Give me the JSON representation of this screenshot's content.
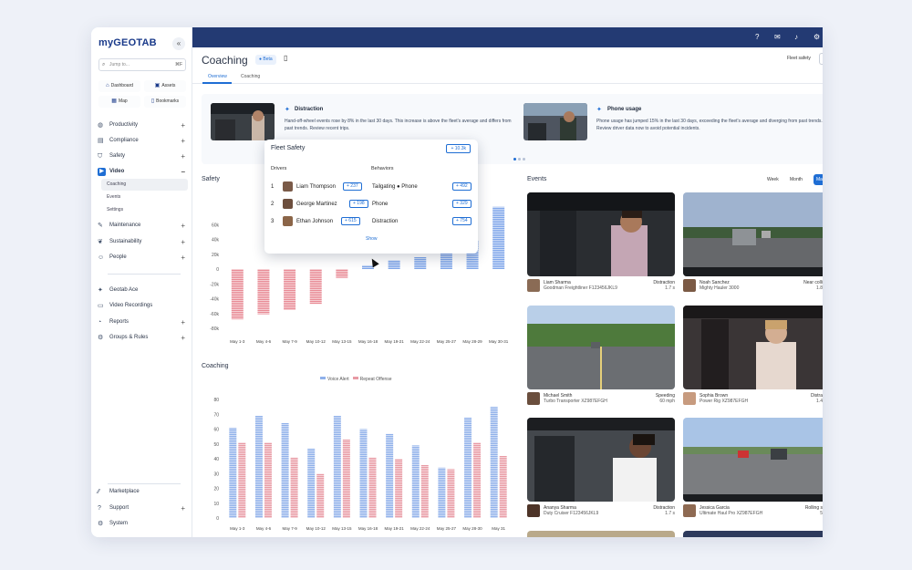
{
  "sidebar": {
    "logo": "myGEOTAB",
    "search_placeholder": "Jump to...",
    "search_shortcut": "⌘F",
    "quick_links": [
      {
        "label": "Dashboard",
        "icon": "dashboard-icon"
      },
      {
        "label": "Assets",
        "icon": "truck-icon"
      },
      {
        "label": "Map",
        "icon": "map-icon"
      },
      {
        "label": "Bookmarks",
        "icon": "bookmark-icon"
      }
    ],
    "nav": [
      {
        "label": "Productivity",
        "icon": "globe-icon",
        "expandable": true
      },
      {
        "label": "Compliance",
        "icon": "clipboard-icon",
        "expandable": true
      },
      {
        "label": "Safety",
        "icon": "shield-icon",
        "expandable": true
      },
      {
        "label": "Video",
        "icon": "video-icon",
        "expandable": true,
        "active": true
      },
      {
        "label": "Maintenance",
        "icon": "wrench-icon",
        "expandable": true
      },
      {
        "label": "Sustainability",
        "icon": "leaf-icon",
        "expandable": true
      },
      {
        "label": "People",
        "icon": "people-icon",
        "expandable": true
      }
    ],
    "video_subnav": [
      "Coaching",
      "Events",
      "Settings"
    ],
    "nav2": [
      {
        "label": "Geotab Ace",
        "icon": "ace-icon",
        "expandable": false
      },
      {
        "label": "Video Recordings",
        "icon": "camera-icon",
        "expandable": false
      },
      {
        "label": "Reports",
        "icon": "reports-icon",
        "expandable": true
      },
      {
        "label": "Groups & Rules",
        "icon": "groups-icon",
        "expandable": true
      }
    ],
    "bottom": [
      {
        "label": "Marketplace",
        "icon": "marketplace-icon",
        "expandable": false
      },
      {
        "label": "Support",
        "icon": "help-icon",
        "expandable": true
      },
      {
        "label": "System",
        "icon": "gear-icon",
        "expandable": false
      }
    ]
  },
  "header": {
    "title": "Coaching",
    "beta": "Beta",
    "fleet_label": "Fleet safety",
    "tabs": [
      "Overview",
      "Coaching"
    ]
  },
  "insights": [
    {
      "title": "Distraction",
      "text": "Hand-off-wheel events rose by 8% in the last 30 days. This increase is above the fleet's average and differs from past trends. Review recent trips."
    },
    {
      "title": "Phone usage",
      "text": "Phone usage has jumped 15% in the last 30 days, exceeding the fleet's average and diverging from past trends. Review driver data now to avoid potential incidents."
    }
  ],
  "popup": {
    "title": "Fleet Safety",
    "total": "+ 10.3k",
    "drivers_header": "Drivers",
    "behaviors_header": "Behaviors",
    "drivers": [
      {
        "rank": "1",
        "name": "Liam Thompson",
        "value": "+ 237"
      },
      {
        "rank": "2",
        "name": "George Martinez",
        "value": "+ 198"
      },
      {
        "rank": "3",
        "name": "Ethan Johnson",
        "value": "+ 615"
      }
    ],
    "behaviors": [
      {
        "name": "Tailgating ● Phone",
        "value": "+ 492"
      },
      {
        "name": "Phone",
        "value": "+ 329"
      },
      {
        "name": "Distraction",
        "value": "+ 754"
      }
    ],
    "show": "Show"
  },
  "safety": {
    "title": "Safety",
    "y_ticks": [
      "60k",
      "40k",
      "20k",
      "0",
      "-20k",
      "-40k",
      "-60k",
      "-80k"
    ],
    "categories": [
      "May 1-3",
      "May 4-6",
      "May 7-9",
      "May 10-12",
      "May 13-15",
      "May 16-18",
      "May 19-21",
      "May 22-24",
      "May 25-27",
      "May 28-29",
      "May 30-31"
    ]
  },
  "coaching": {
    "title": "Coaching",
    "legend": [
      "Voice Alert",
      "Repeat Offense"
    ],
    "y_ticks": [
      "80",
      "70",
      "60",
      "50",
      "40",
      "30",
      "20",
      "10",
      "0"
    ],
    "categories": [
      "May 1-3",
      "May 4-6",
      "May 7-9",
      "May 10-12",
      "May 13-15",
      "May 16-18",
      "May 19-21",
      "May 22-24",
      "May 25-27",
      "May 28-30",
      "May 31"
    ]
  },
  "events": {
    "title": "Events",
    "ranges": [
      "Week",
      "Month",
      "Ma"
    ],
    "cards": [
      {
        "name": "Liam Sharma",
        "vehicle": "Goodman Freightliner F123456JKL9",
        "type": "Distraction",
        "value": "1.7 s"
      },
      {
        "name": "Noah Sanchez",
        "vehicle": "Mighty Hauler 3000",
        "type": "Near colli",
        "value": "1.8"
      },
      {
        "name": "Michael Smith",
        "vehicle": "Turbo Transporter XZ987EFGH",
        "type": "Speeding",
        "value": "60 mph"
      },
      {
        "name": "Sophia Brown",
        "vehicle": "Power Rig XZ987EFGH",
        "type": "Distra",
        "value": "1.4"
      },
      {
        "name": "Ananya Sharma",
        "vehicle": "Duty Cruiser F123456JKL9",
        "type": "Distraction",
        "value": "1.7 s"
      },
      {
        "name": "Jessica Garcia",
        "vehicle": "Ultimate Haul Pro XZ987EFGH",
        "type": "Rolling s",
        "value": "5"
      }
    ]
  },
  "chart_data": [
    {
      "type": "bar",
      "title": "Safety",
      "categories": [
        "May 1-3",
        "May 4-6",
        "May 7-9",
        "May 10-12",
        "May 13-15",
        "May 16-18",
        "May 19-21",
        "May 22-24",
        "May 25-27",
        "May 28-29",
        "May 30-31"
      ],
      "series": [
        {
          "values": [
            -68000,
            -61000,
            -55000,
            -47000,
            -12000,
            5000,
            12000,
            16000,
            22000,
            38000,
            84000
          ]
        }
      ],
      "ylim": [
        -80000,
        80000
      ],
      "colors": {
        "positive": "#7fa6ea",
        "negative": "#e88a95"
      }
    },
    {
      "type": "bar",
      "title": "Coaching",
      "categories": [
        "May 1-3",
        "May 4-6",
        "May 7-9",
        "May 10-12",
        "May 13-15",
        "May 16-18",
        "May 19-21",
        "May 22-24",
        "May 25-27",
        "May 28-30",
        "May 31"
      ],
      "series": [
        {
          "name": "Voice Alert",
          "values": [
            61,
            69,
            64,
            47,
            69,
            60,
            57,
            49,
            34,
            68,
            75
          ]
        },
        {
          "name": "Repeat Offense",
          "values": [
            51,
            51,
            41,
            30,
            53,
            41,
            40,
            36,
            33,
            51,
            42
          ]
        }
      ],
      "ylim": [
        0,
        80
      ],
      "colors": {
        "Voice Alert": "#8fb0ea",
        "Repeat Offense": "#e89aa4"
      }
    }
  ]
}
